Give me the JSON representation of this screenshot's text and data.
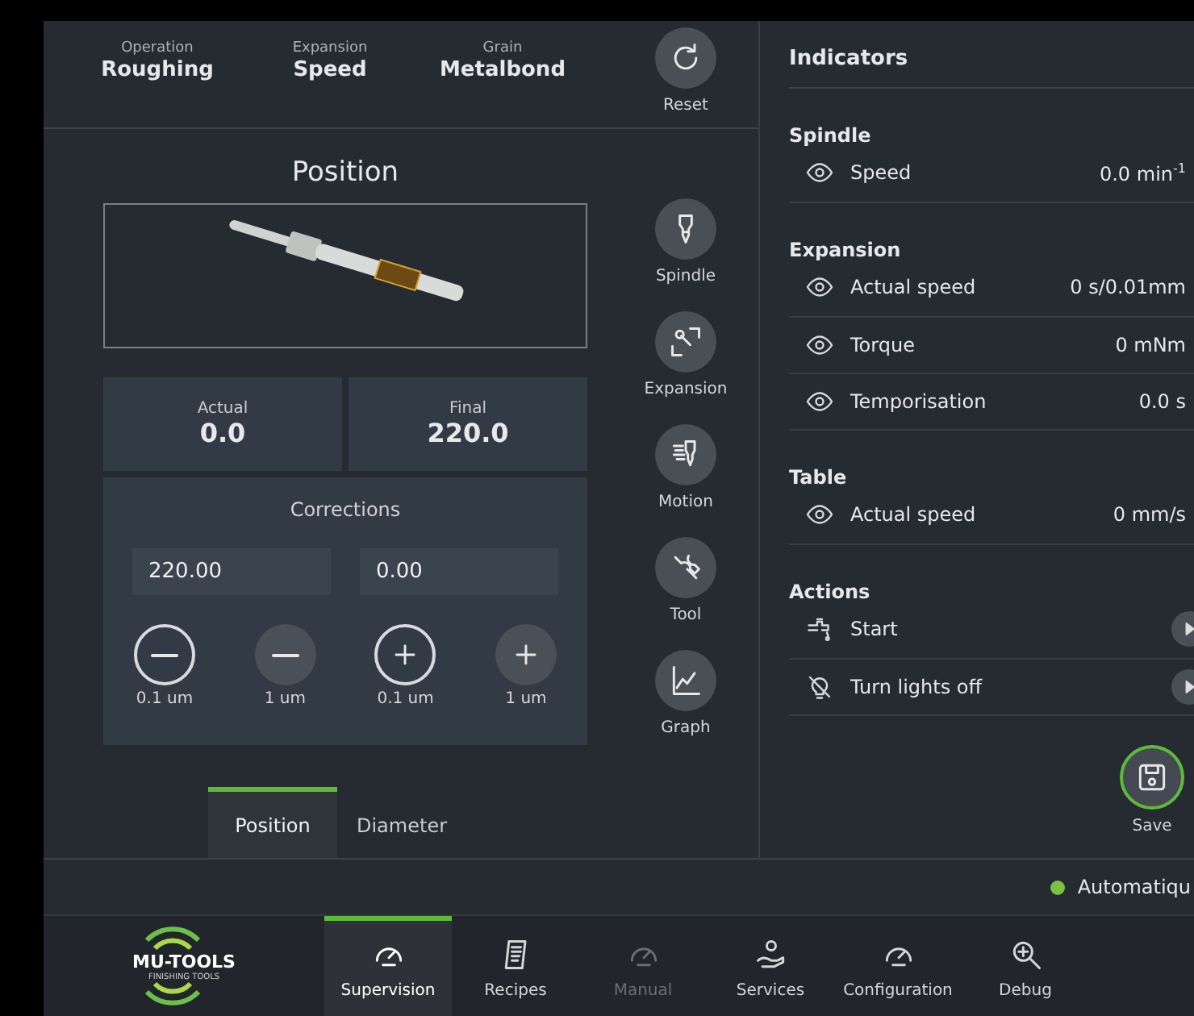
{
  "summary": [
    {
      "label": "Operation",
      "value": "Roughing"
    },
    {
      "label": "Expansion",
      "value": "Speed"
    },
    {
      "label": "Grain",
      "value": "Metalbond"
    }
  ],
  "reset": {
    "label": "Reset"
  },
  "position": {
    "title": "Position",
    "actual": {
      "label": "Actual",
      "value": "0.0"
    },
    "final": {
      "label": "Final",
      "value": "220.0"
    },
    "corrections": {
      "title": "Corrections",
      "fields": [
        "220.00",
        "0.00"
      ],
      "steps": [
        {
          "kind": "minus",
          "outlined": true,
          "label": "0.1 um"
        },
        {
          "kind": "minus",
          "outlined": false,
          "label": "1 um"
        },
        {
          "kind": "plus",
          "outlined": true,
          "label": "0.1 um"
        },
        {
          "kind": "plus",
          "outlined": false,
          "label": "1 um"
        }
      ]
    }
  },
  "tools": [
    {
      "kind": "spindle",
      "label": "Spindle"
    },
    {
      "kind": "expansion",
      "label": "Expansion"
    },
    {
      "kind": "motion",
      "label": "Motion"
    },
    {
      "kind": "tool",
      "label": "Tool"
    },
    {
      "kind": "graph",
      "label": "Graph"
    }
  ],
  "tabs": [
    {
      "label": "Position",
      "selected": true
    },
    {
      "label": "Diameter",
      "selected": false
    }
  ],
  "indicators": {
    "title": "Indicators",
    "groups": [
      {
        "title": "Spindle",
        "items": [
          {
            "kind": "reading",
            "label": "Speed",
            "value": "0.0  min$^{-1}$"
          }
        ]
      },
      {
        "title": "Expansion",
        "items": [
          {
            "kind": "reading",
            "label": "Actual speed",
            "value": "0  s/0.01mm"
          },
          {
            "kind": "reading",
            "label": "Torque",
            "value": "0  mNm"
          },
          {
            "kind": "reading",
            "label": "Temporisation",
            "value": "0.0 s"
          }
        ]
      },
      {
        "title": "Table",
        "items": [
          {
            "kind": "reading",
            "label": "Actual speed",
            "value": "0  mm/s"
          }
        ]
      },
      {
        "title": "Actions",
        "items": [
          {
            "kind": "faucet",
            "label": "Start"
          },
          {
            "kind": "bulb",
            "label": "Turn lights off"
          }
        ]
      }
    ]
  },
  "save": {
    "label": "Save"
  },
  "status": {
    "label": "Automatiqu",
    "color": "#7cc242"
  },
  "logo": {
    "name": "MU-TOOLS",
    "tagline": "FINISHING TOOLS"
  },
  "nav": [
    {
      "kind": "gauge",
      "label": "Supervision",
      "selected": true,
      "disabled": false
    },
    {
      "kind": "recipe",
      "label": "Recipes",
      "selected": false,
      "disabled": false
    },
    {
      "kind": "gauge",
      "label": "Manual",
      "selected": false,
      "disabled": true
    },
    {
      "kind": "services",
      "label": "Services",
      "selected": false,
      "disabled": false
    },
    {
      "kind": "gauge",
      "label": "Configuration",
      "selected": false,
      "disabled": false
    },
    {
      "kind": "debug",
      "label": "Debug",
      "selected": false,
      "disabled": false
    }
  ]
}
